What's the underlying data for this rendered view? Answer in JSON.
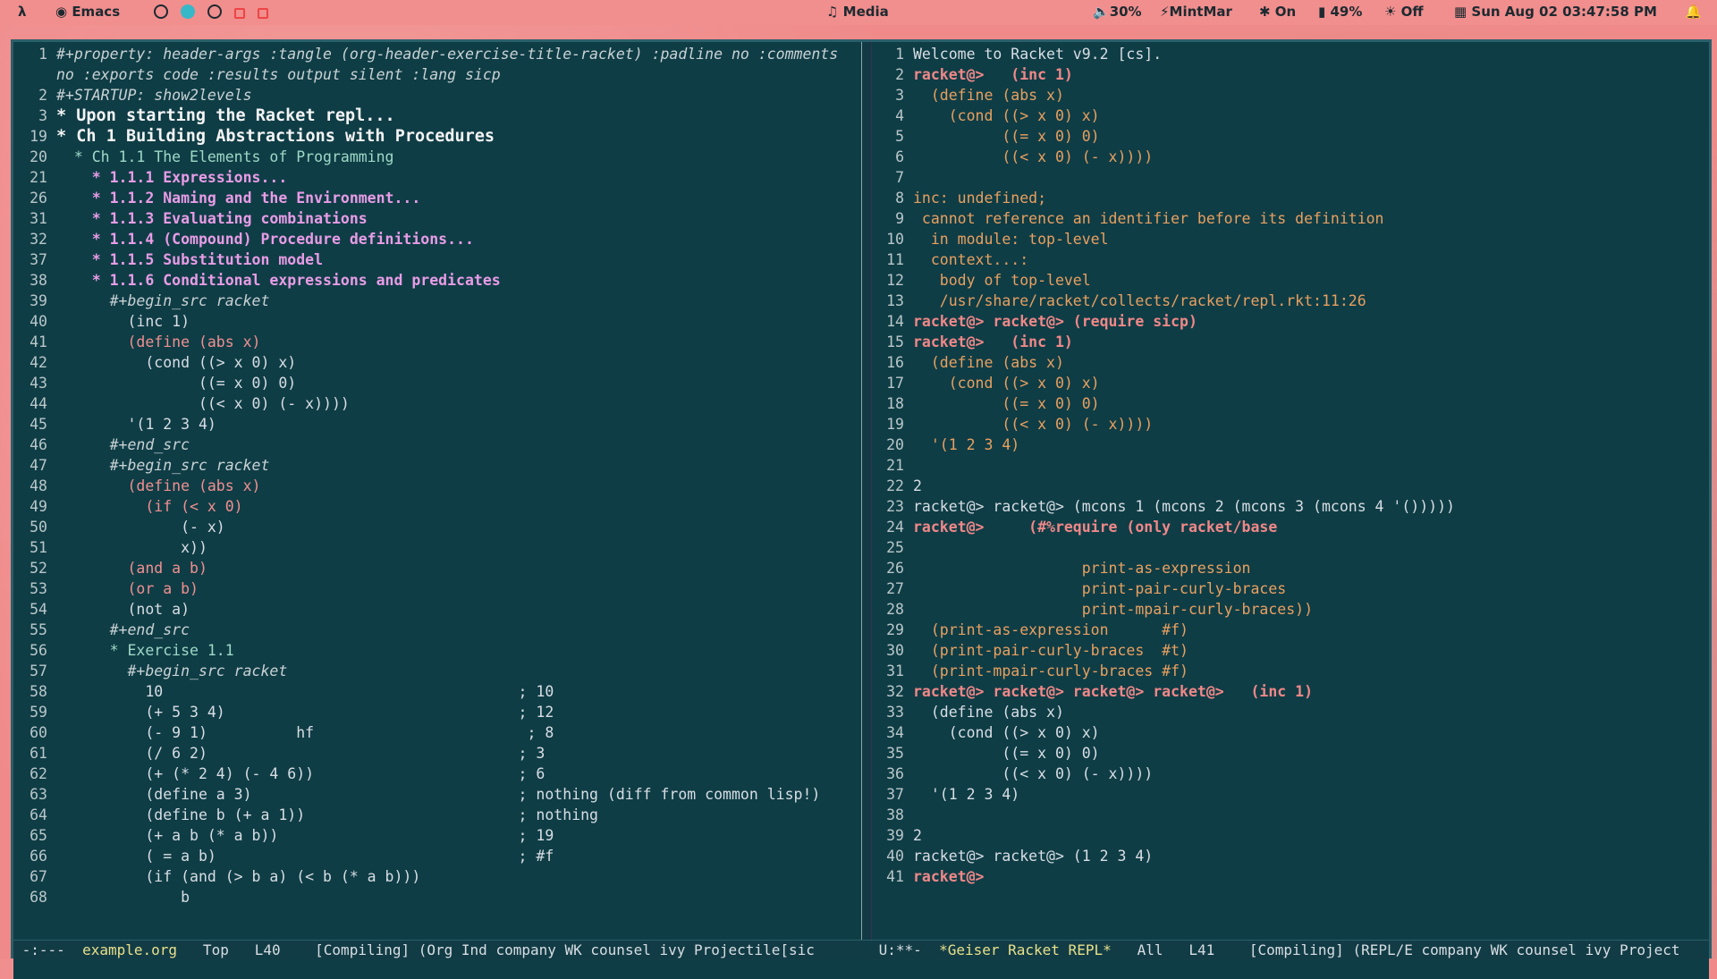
{
  "topbar": {
    "app_icon": "lambda-icon",
    "app_name": "Emacs",
    "media_label": "Media",
    "volume": "30%",
    "user": "MintMar",
    "bluetooth": "On",
    "battery": "49%",
    "brightness": "Off",
    "datetime": "Sun Aug 02 03:47:58 PM"
  },
  "left": {
    "lines": [
      {
        "n": "1",
        "t": "#+property: header-args :tangle (org-header-exercise-title-racket) :padline no :comments",
        "c": "comment"
      },
      {
        "n": "",
        "t": "no :exports code :results output silent :lang sicp",
        "c": "comment"
      },
      {
        "n": "2",
        "t": "#+STARTUP: show2levels",
        "c": "comment"
      },
      {
        "n": "3",
        "t": "* Upon starting the Racket repl...",
        "c": "h1"
      },
      {
        "n": "19",
        "t": "* Ch 1 Building Abstractions with Procedures",
        "c": "h1"
      },
      {
        "n": "20",
        "t": "  * Ch 1.1 The Elements of Programming",
        "c": "h2"
      },
      {
        "n": "21",
        "t": "    * 1.1.1 Expressions...",
        "c": "h3"
      },
      {
        "n": "26",
        "t": "    * 1.1.2 Naming and the Environment...",
        "c": "h3"
      },
      {
        "n": "31",
        "t": "    * 1.1.3 Evaluating combinations",
        "c": "h3"
      },
      {
        "n": "32",
        "t": "    * 1.1.4 (Compound) Procedure definitions...",
        "c": "h3"
      },
      {
        "n": "37",
        "t": "    * 1.1.5 Substitution model",
        "c": "h3"
      },
      {
        "n": "38",
        "t": "    * 1.1.6 Conditional expressions and predicates",
        "c": "h3"
      },
      {
        "n": "39",
        "t": "      #+begin_src racket",
        "c": "comment"
      },
      {
        "n": "40",
        "t": "        (inc 1)",
        "c": ""
      },
      {
        "n": "41",
        "t": "        (define (abs x)",
        "c": "kw"
      },
      {
        "n": "42",
        "t": "          (cond ((> x 0) x)",
        "c": ""
      },
      {
        "n": "43",
        "t": "                ((= x 0) 0)",
        "c": ""
      },
      {
        "n": "44",
        "t": "                ((< x 0) (- x))))",
        "c": ""
      },
      {
        "n": "45",
        "t": "        '(1 2 3 4)",
        "c": ""
      },
      {
        "n": "46",
        "t": "      #+end_src",
        "c": "comment"
      },
      {
        "n": "47",
        "t": "      #+begin_src racket",
        "c": "comment"
      },
      {
        "n": "48",
        "t": "        (define (abs x)",
        "c": "kw"
      },
      {
        "n": "49",
        "t": "          (if (< x 0)",
        "c": "kw"
      },
      {
        "n": "50",
        "t": "              (- x)",
        "c": ""
      },
      {
        "n": "51",
        "t": "              x))",
        "c": ""
      },
      {
        "n": "52",
        "t": "        (and a b)",
        "c": "kw"
      },
      {
        "n": "53",
        "t": "        (or a b)",
        "c": "kw"
      },
      {
        "n": "54",
        "t": "        (not a)",
        "c": ""
      },
      {
        "n": "55",
        "t": "      #+end_src",
        "c": "comment"
      },
      {
        "n": "56",
        "t": "      * Exercise 1.1",
        "c": "h2"
      },
      {
        "n": "57",
        "t": "        #+begin_src racket",
        "c": "comment"
      },
      {
        "n": "58",
        "t": "          10                                        ; 10",
        "c": ""
      },
      {
        "n": "59",
        "t": "          (+ 5 3 4)                                 ; 12",
        "c": ""
      },
      {
        "n": "60",
        "t": "          (- 9 1)          hf                        ; 8",
        "c": ""
      },
      {
        "n": "61",
        "t": "          (/ 6 2)                                   ; 3",
        "c": ""
      },
      {
        "n": "62",
        "t": "          (+ (* 2 4) (- 4 6))                       ; 6",
        "c": ""
      },
      {
        "n": "63",
        "t": "          (define a 3)                              ; nothing (diff from common lisp!)",
        "c": ""
      },
      {
        "n": "64",
        "t": "          (define b (+ a 1))                        ; nothing",
        "c": ""
      },
      {
        "n": "65",
        "t": "          (+ a b (* a b))                           ; 19",
        "c": ""
      },
      {
        "n": "66",
        "t": "          ( = a b)                                  ; #f",
        "c": ""
      },
      {
        "n": "67",
        "t": "          (if (and (> b a) (< b (* a b)))",
        "c": ""
      },
      {
        "n": "68",
        "t": "              b",
        "c": ""
      }
    ],
    "modeline_status": " -:---  ",
    "modeline_buffer": "example.org",
    "modeline_rest": "   Top   L40    [Compiling] (Org Ind company WK counsel ivy Projectile[sic"
  },
  "right": {
    "lines": [
      {
        "n": "1",
        "t": "Welcome to Racket v9.2 [cs].",
        "c": ""
      },
      {
        "n": "2",
        "t": "racket@>   (inc 1)",
        "c": "prompt"
      },
      {
        "n": "3",
        "t": "  (define (abs x)",
        "c": "err"
      },
      {
        "n": "4",
        "t": "    (cond ((> x 0) x)",
        "c": "err"
      },
      {
        "n": "5",
        "t": "          ((= x 0) 0)",
        "c": "err"
      },
      {
        "n": "6",
        "t": "          ((< x 0) (- x))))",
        "c": "err"
      },
      {
        "n": "7",
        "t": "",
        "c": ""
      },
      {
        "n": "8",
        "t": "inc: undefined;",
        "c": "err"
      },
      {
        "n": "9",
        "t": " cannot reference an identifier before its definition",
        "c": "err"
      },
      {
        "n": "10",
        "t": "  in module: top-level",
        "c": "err"
      },
      {
        "n": "11",
        "t": "  context...:",
        "c": "err"
      },
      {
        "n": "12",
        "t": "   body of top-level",
        "c": "err"
      },
      {
        "n": "13",
        "t": "   /usr/share/racket/collects/racket/repl.rkt:11:26",
        "c": "err"
      },
      {
        "n": "14",
        "t": "racket@> racket@> (require sicp)",
        "c": "prompt"
      },
      {
        "n": "15",
        "t": "racket@>   (inc 1)",
        "c": "prompt"
      },
      {
        "n": "16",
        "t": "  (define (abs x)",
        "c": "err"
      },
      {
        "n": "17",
        "t": "    (cond ((> x 0) x)",
        "c": "err"
      },
      {
        "n": "18",
        "t": "          ((= x 0) 0)",
        "c": "err"
      },
      {
        "n": "19",
        "t": "          ((< x 0) (- x))))",
        "c": "err"
      },
      {
        "n": "20",
        "t": "  '(1 2 3 4)",
        "c": "err"
      },
      {
        "n": "21",
        "t": "",
        "c": ""
      },
      {
        "n": "22",
        "t": "2",
        "c": ""
      },
      {
        "n": "23",
        "t": "racket@> racket@> (mcons 1 (mcons 2 (mcons 3 (mcons 4 '()))))",
        "c": ""
      },
      {
        "n": "24",
        "t": "racket@>     (#%require (only racket/base",
        "c": "prompt"
      },
      {
        "n": "25",
        "t": "",
        "c": ""
      },
      {
        "n": "26",
        "t": "                   print-as-expression",
        "c": "err"
      },
      {
        "n": "27",
        "t": "                   print-pair-curly-braces",
        "c": "err"
      },
      {
        "n": "28",
        "t": "                   print-mpair-curly-braces))",
        "c": "err"
      },
      {
        "n": "29",
        "t": "  (print-as-expression      #f)",
        "c": "err"
      },
      {
        "n": "30",
        "t": "  (print-pair-curly-braces  #t)",
        "c": "err"
      },
      {
        "n": "31",
        "t": "  (print-mpair-curly-braces #f)",
        "c": "err"
      },
      {
        "n": "32",
        "t": "racket@> racket@> racket@> racket@>   (inc 1)",
        "c": "prompt"
      },
      {
        "n": "33",
        "t": "  (define (abs x)",
        "c": ""
      },
      {
        "n": "34",
        "t": "    (cond ((> x 0) x)",
        "c": ""
      },
      {
        "n": "35",
        "t": "          ((= x 0) 0)",
        "c": ""
      },
      {
        "n": "36",
        "t": "          ((< x 0) (- x))))",
        "c": ""
      },
      {
        "n": "37",
        "t": "  '(1 2 3 4)",
        "c": ""
      },
      {
        "n": "38",
        "t": "",
        "c": ""
      },
      {
        "n": "39",
        "t": "2",
        "c": ""
      },
      {
        "n": "40",
        "t": "racket@> racket@> (1 2 3 4)",
        "c": ""
      },
      {
        "n": "41",
        "t": "racket@>",
        "c": "prompt"
      }
    ],
    "modeline_status": " U:**-  ",
    "modeline_buffer": "*Geiser Racket REPL*",
    "modeline_rest": "   All   L41    [Compiling] (REPL/E company WK counsel ivy Project"
  }
}
